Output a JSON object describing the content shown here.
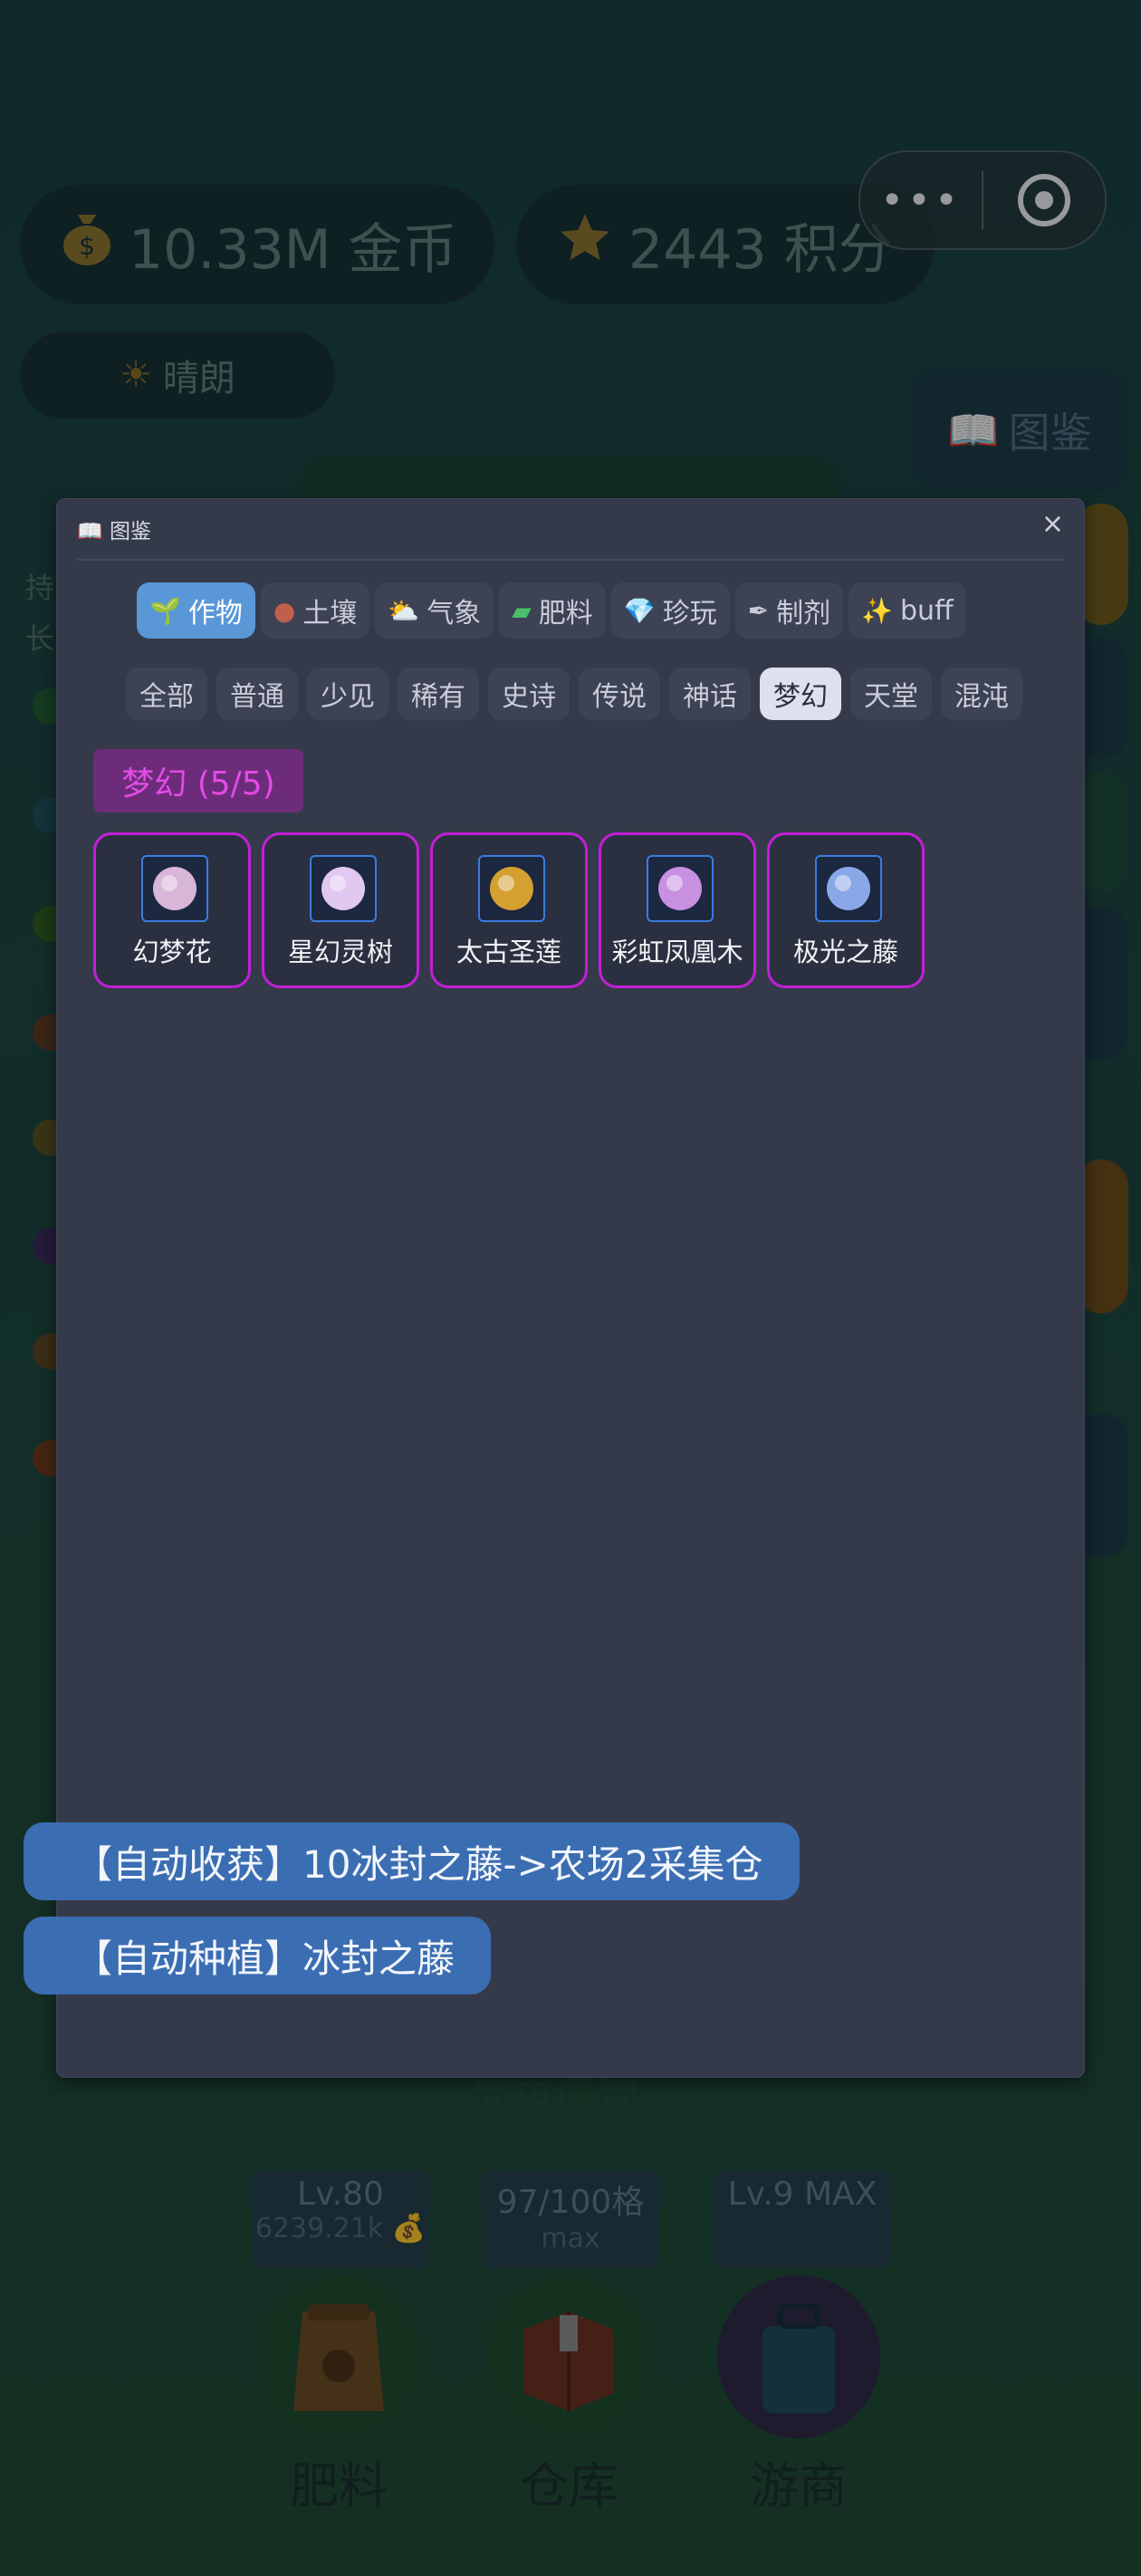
{
  "hud": {
    "coins": "10.33M 金币",
    "coin_icon": "money-bag-icon",
    "score": "2443 积分",
    "score_icon": "star-icon",
    "weather": "晴朗",
    "weather_icon": "sun-icon",
    "codex_button": "图鉴",
    "side_hint_1": "持",
    "side_hint_2": "长",
    "farm_hint": "点击播种"
  },
  "capsule": {
    "more": "•••",
    "more_icon": "more-dots-icon",
    "close_icon": "target-circle-icon"
  },
  "modal": {
    "title": "📖 图鉴",
    "close": "×",
    "categories": [
      {
        "icon": "🌱",
        "label": "作物",
        "active": true
      },
      {
        "icon": "●",
        "label": "土壤",
        "active": false
      },
      {
        "icon": "⛅",
        "label": "气象",
        "active": false
      },
      {
        "icon": "▰",
        "label": "肥料",
        "active": false
      },
      {
        "icon": "💎",
        "label": "珍玩",
        "active": false
      },
      {
        "icon": "✒",
        "label": "制剂",
        "active": false
      },
      {
        "icon": "✨",
        "label": "buff",
        "active": false
      }
    ],
    "rarities": [
      {
        "label": "全部",
        "active": false
      },
      {
        "label": "普通",
        "active": false
      },
      {
        "label": "少见",
        "active": false
      },
      {
        "label": "稀有",
        "active": false
      },
      {
        "label": "史诗",
        "active": false
      },
      {
        "label": "传说",
        "active": false
      },
      {
        "label": "神话",
        "active": false
      },
      {
        "label": "梦幻",
        "active": true
      },
      {
        "label": "天堂",
        "active": false
      },
      {
        "label": "混沌",
        "active": false
      }
    ],
    "section": "梦幻 (5/5)",
    "items": [
      {
        "name": "幻梦花",
        "icon": "dream-flower-icon",
        "color": "#d8b6d8"
      },
      {
        "name": "星幻灵树",
        "icon": "star-spirit-tree-icon",
        "color": "#e0c8f0"
      },
      {
        "name": "太古圣莲",
        "icon": "ancient-lotus-icon",
        "color": "#d4a030"
      },
      {
        "name": "彩虹凤凰木",
        "icon": "rainbow-phoenix-wood-icon",
        "color": "#c890e0"
      },
      {
        "name": "极光之藤",
        "icon": "aurora-vine-icon",
        "color": "#8aa8e8"
      }
    ]
  },
  "toasts": [
    "【自动收获】10冰封之藤->农场2采集仓",
    "【自动种植】冰封之藤"
  ],
  "bottom": {
    "level": "Lv.80",
    "level_sub": "6239.21k 💰",
    "storage": "97/100格",
    "storage_sub": "max",
    "merchant_level": "Lv.9 MAX",
    "fertilizer": "肥料",
    "warehouse": "仓库",
    "merchant": "游商"
  },
  "colors": {
    "accent_blue": "#5a97d6",
    "dream_purple": "#c21fd8",
    "toast_blue": "#3b6db2",
    "modal_bg": "#353a4b"
  }
}
